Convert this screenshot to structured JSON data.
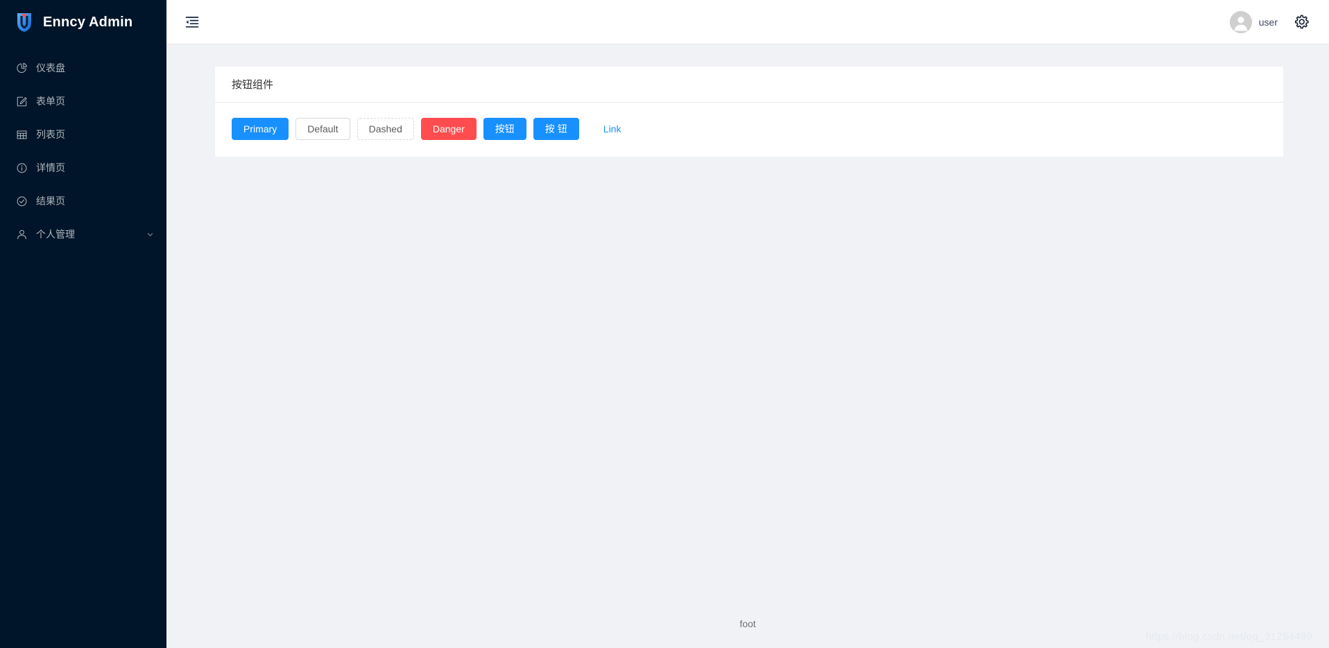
{
  "sidebar": {
    "logo": {
      "icon": "shield-u-logo-icon",
      "title": "Enncy Admin",
      "colors": {
        "blue_light": "#4aa8f0",
        "blue_dark": "#1565d8",
        "accent_red": "#ff4d4f"
      }
    },
    "items": [
      {
        "icon": "pie-chart-icon",
        "label": "仪表盘",
        "expandable": false
      },
      {
        "icon": "form-edit-icon",
        "label": "表单页",
        "expandable": false
      },
      {
        "icon": "table-icon",
        "label": "列表页",
        "expandable": false
      },
      {
        "icon": "info-circle-icon",
        "label": "详情页",
        "expandable": false
      },
      {
        "icon": "check-circle-icon",
        "label": "结果页",
        "expandable": false
      },
      {
        "icon": "user-icon",
        "label": "个人管理",
        "expandable": true
      }
    ]
  },
  "topbar": {
    "fold_icon": "menu-fold-icon",
    "user": {
      "avatar_icon": "user-avatar-icon",
      "name": "user"
    },
    "settings_icon": "gear-icon"
  },
  "card": {
    "title": "按钮组件",
    "buttons": [
      {
        "label": "Primary",
        "style": "primary"
      },
      {
        "label": "Default",
        "style": "default"
      },
      {
        "label": "Dashed",
        "style": "dashed"
      },
      {
        "label": "Danger",
        "style": "danger"
      },
      {
        "label": "按钮",
        "style": "primary"
      },
      {
        "label": "按钮",
        "style": "primary-spaced"
      },
      {
        "label": "Link",
        "style": "link"
      }
    ]
  },
  "footer": {
    "text": "foot"
  },
  "watermark": {
    "text": "https://blog.csdn.net/qq_31254489"
  },
  "theme": {
    "sidebar_bg": "#001529",
    "content_bg": "#f0f2f5",
    "primary": "#1890ff",
    "danger": "#ff4d4f",
    "border": "#e8e8e8"
  }
}
